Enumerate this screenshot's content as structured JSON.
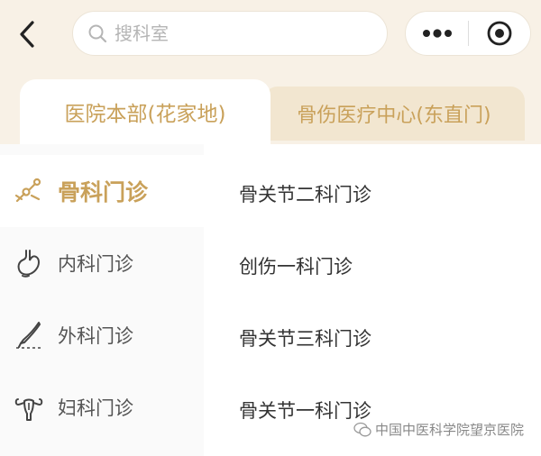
{
  "search": {
    "placeholder": "搜科室"
  },
  "tabs": [
    {
      "label": "医院本部(花家地)",
      "active": true
    },
    {
      "label": "骨伤医疗中心(东直门)",
      "active": false
    }
  ],
  "sidebar": {
    "items": [
      {
        "label": "骨科门诊",
        "icon": "bone-icon",
        "active": true
      },
      {
        "label": "内科门诊",
        "icon": "stomach-icon",
        "active": false
      },
      {
        "label": "外科门诊",
        "icon": "scalpel-icon",
        "active": false
      },
      {
        "label": "妇科门诊",
        "icon": "uterus-icon",
        "active": false
      }
    ]
  },
  "departments": [
    "骨关节二科门诊",
    "创伤一科门诊",
    "骨关节三科门诊",
    "骨关节一科门诊"
  ],
  "watermark": {
    "text": "中国中医科学院望京医院"
  },
  "colors": {
    "accent": "#c9a15a",
    "header_bg": "#f8f1e6",
    "tab_inactive_bg": "#f2e6d0"
  }
}
